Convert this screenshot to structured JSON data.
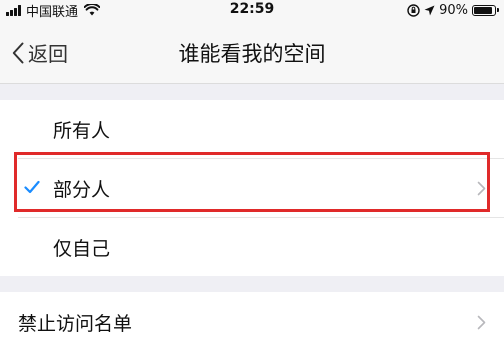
{
  "status_bar": {
    "carrier": "中国联通",
    "time": "22:59",
    "battery_percent": "90%",
    "battery_level": 0.9,
    "icons": [
      "signal-bars-icon",
      "wifi-icon",
      "orientation-lock-icon",
      "location-arrow-icon",
      "battery-icon"
    ]
  },
  "nav": {
    "back_label": "返回",
    "title": "谁能看我的空间"
  },
  "options": {
    "items": [
      {
        "label": "所有人",
        "selected": false
      },
      {
        "label": "部分人",
        "selected": true,
        "has_chevron": true
      },
      {
        "label": "仅自己",
        "selected": false
      }
    ]
  },
  "blocklist": {
    "label": "禁止访问名单"
  },
  "colors": {
    "accent_check": "#1a8cff",
    "highlight_border": "#e02a2a",
    "background": "#efeff4"
  }
}
